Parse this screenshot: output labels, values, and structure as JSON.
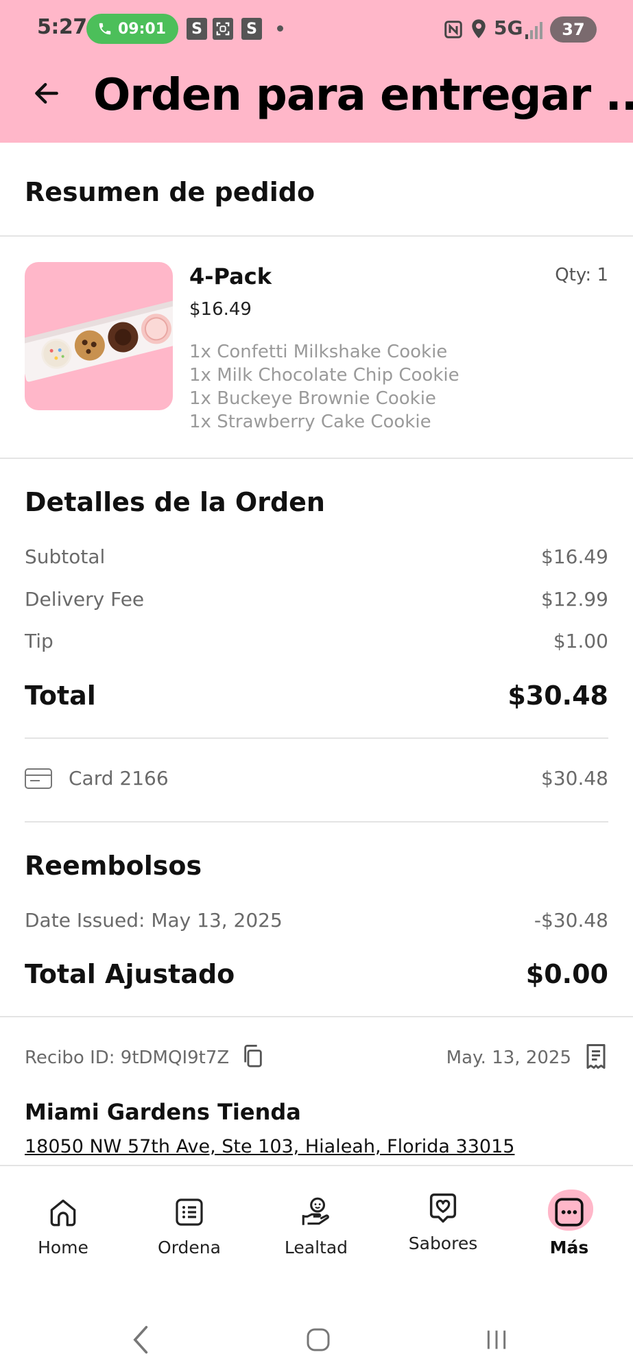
{
  "status_bar": {
    "time": "5:27",
    "call_timer": "09:01",
    "network": "5G",
    "battery": "37",
    "icons": [
      "phone-icon",
      "s-app-icon",
      "screenshot-icon",
      "s-app-icon",
      "dot-icon",
      "nfc-icon",
      "location-icon",
      "signal-icon",
      "battery-icon"
    ]
  },
  "header": {
    "title": "Orden para entregar ...",
    "back_icon": "arrow-left-icon",
    "color": "#ffb7c9"
  },
  "summary": {
    "title": "Resumen de pedido",
    "product": {
      "name": "4-Pack",
      "price": "$16.49",
      "qty": "Qty: 1",
      "items": [
        "1x Confetti Milkshake Cookie",
        "1x Milk Chocolate Chip Cookie",
        "1x Buckeye Brownie Cookie",
        "1x Strawberry Cake Cookie"
      ]
    }
  },
  "details": {
    "title": "Detalles de la Orden",
    "rows": [
      {
        "label": "Subtotal",
        "value": "$16.49"
      },
      {
        "label": "Delivery Fee",
        "value": "$12.99"
      },
      {
        "label": "Tip",
        "value": "$1.00"
      }
    ],
    "total_label": "Total",
    "total_value": "$30.48",
    "payment_label": "Card 2166",
    "payment_value": "$30.48"
  },
  "refunds": {
    "title": "Reembolsos",
    "date_label": "Date Issued: May 13, 2025",
    "date_value": "-$30.48",
    "adjusted_label": "Total Ajustado",
    "adjusted_value": "$0.00"
  },
  "receipt": {
    "id_label": "Recibo ID: 9tDMQI9t7Z",
    "date": "May. 13, 2025"
  },
  "store": {
    "name": "Miami Gardens Tienda",
    "address": "18050 NW 57th Ave, Ste 103, Hialeah, Florida 33015"
  },
  "bottom_nav": {
    "items": [
      {
        "label": "Home",
        "icon": "home-icon"
      },
      {
        "label": "Ordena",
        "icon": "list-icon"
      },
      {
        "label": "Lealtad",
        "icon": "loyalty-icon"
      },
      {
        "label": "Sabores",
        "icon": "heart-tag-icon"
      },
      {
        "label": "Más",
        "icon": "more-icon"
      }
    ],
    "active": "Más"
  }
}
